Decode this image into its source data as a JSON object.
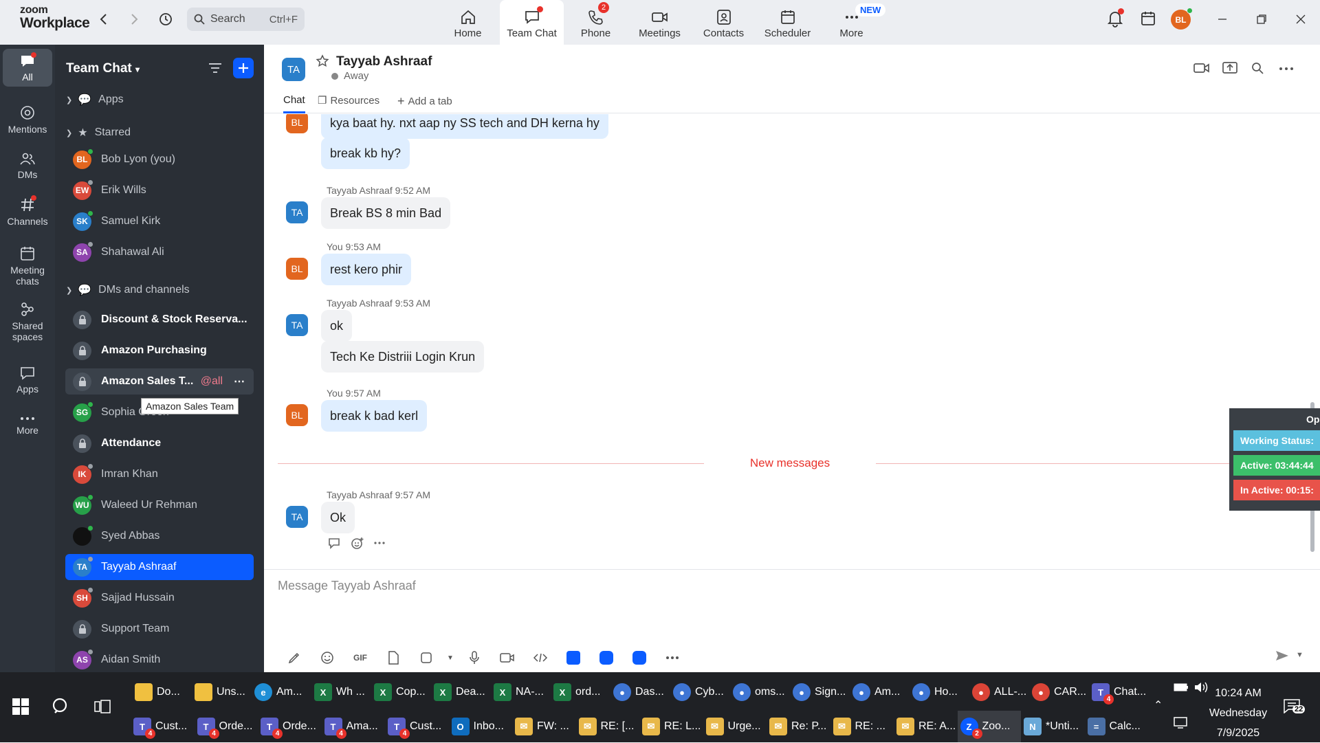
{
  "app": {
    "brand_top": "zoom",
    "brand_bottom": "Workplace"
  },
  "search": {
    "placeholder": "Search",
    "shortcut": "Ctrl+F"
  },
  "nav_tabs": [
    {
      "label": "Home",
      "icon": "home-icon"
    },
    {
      "label": "Team Chat",
      "icon": "team-chat-icon",
      "active": true
    },
    {
      "label": "Phone",
      "icon": "phone-icon",
      "badge": "2"
    },
    {
      "label": "Meetings",
      "icon": "video-icon"
    },
    {
      "label": "Contacts",
      "icon": "contacts-icon"
    },
    {
      "label": "Scheduler",
      "icon": "calendar-icon"
    },
    {
      "label": "More",
      "icon": "more-icon",
      "tag": "NEW"
    }
  ],
  "profile": {
    "initials": "BL",
    "status_color": "#2fb54b"
  },
  "left_rail": [
    {
      "label": "All",
      "icon": "chat-bubble-icon",
      "active": true
    },
    {
      "label": "Mentions",
      "icon": "at-icon"
    },
    {
      "label": "DMs",
      "icon": "people-icon"
    },
    {
      "label": "Channels",
      "icon": "hash-icon"
    },
    {
      "label": "Meeting chats",
      "icon": "calendar-icon"
    },
    {
      "label": "Shared spaces",
      "icon": "shared-icon"
    },
    {
      "label": "Apps",
      "icon": "apps-icon"
    },
    {
      "label": "More",
      "icon": "more-icon"
    }
  ],
  "sidebar": {
    "title": "Team Chat",
    "apps_label": "Apps",
    "starred_label": "Starred",
    "dms_label": "DMs and channels",
    "starred": [
      {
        "name": "Bob Lyon (you)",
        "initials": "BL",
        "color": "#e2661f",
        "status": "#2fb54b"
      },
      {
        "name": "Erik Wills",
        "initials": "EW",
        "color": "#d94a3b",
        "status": "#9aa0a6"
      },
      {
        "name": "Samuel Kirk",
        "initials": "SK",
        "color": "#2a7fca",
        "status": "#2fb54b"
      },
      {
        "name": "Shahawal Ali",
        "initials": "SA",
        "color": "#8e44ad",
        "status": "#9aa0a6"
      }
    ],
    "channels": [
      {
        "name": "Discount & Stock Reserva...",
        "type": "lock",
        "bold": true
      },
      {
        "name": "Amazon Purchasing",
        "type": "lock",
        "bold": true
      },
      {
        "name": "Amazon Sales T...",
        "type": "lock",
        "bold": true,
        "mention": "@all"
      },
      {
        "name": "Sophia Green",
        "initials": "SG",
        "color": "#27a049",
        "status": "#2fb54b"
      },
      {
        "name": "Attendance",
        "type": "lock",
        "bold": true
      },
      {
        "name": "Imran Khan",
        "initials": "IK",
        "color": "#d94a3b",
        "status": "#9aa0a6"
      },
      {
        "name": "Waleed Ur Rehman",
        "initials": "WU",
        "color": "#27a049",
        "status": "#2fb54b"
      },
      {
        "name": "Syed Abbas",
        "initials": "",
        "color": "#111111",
        "status": "#2fb54b"
      },
      {
        "name": "Tayyab Ashraaf",
        "initials": "TA",
        "color": "#2a7fca",
        "status": "#9aa0a6",
        "selected": true
      },
      {
        "name": "Sajjad Hussain",
        "initials": "SH",
        "color": "#d94a3b",
        "status": "#9aa0a6"
      },
      {
        "name": "Support Team",
        "type": "lock"
      },
      {
        "name": "Aidan Smith",
        "initials": "AS",
        "color": "#8e44ad",
        "status": "#9aa0a6"
      }
    ],
    "tooltip": "Amazon Sales Team"
  },
  "chat": {
    "initials": "TA",
    "name": "Tayyab Ashraaf",
    "status": "Away",
    "tabs": [
      "Chat",
      "Resources",
      "Add a tab"
    ],
    "messages": [
      {
        "type": "bubble",
        "from": "me",
        "text": "kya baat hy. nxt aap ny SS tech and DH kerna hy",
        "avatar": true
      },
      {
        "type": "bubble",
        "from": "me",
        "text": "break kb hy?"
      },
      {
        "type": "meta",
        "text": "Tayyab Ashraaf 9:52 AM"
      },
      {
        "type": "bubble",
        "from": "them",
        "text": "Break BS 8 min Bad",
        "avatar": true
      },
      {
        "type": "meta",
        "text": "You 9:53 AM"
      },
      {
        "type": "bubble",
        "from": "me",
        "text": "rest kero phir",
        "avatar": true
      },
      {
        "type": "meta",
        "text": "Tayyab Ashraaf 9:53 AM"
      },
      {
        "type": "bubble",
        "from": "them",
        "text": "ok",
        "avatar": true
      },
      {
        "type": "bubble",
        "from": "them",
        "text": "Tech Ke Distriii Login Krun"
      },
      {
        "type": "meta",
        "text": "You 9:57 AM"
      },
      {
        "type": "bubble",
        "from": "me",
        "text": "break k bad kerl",
        "avatar": true
      },
      {
        "type": "meta",
        "text": "Tayyab Ashraaf 9:57 AM"
      },
      {
        "type": "bubble",
        "from": "them",
        "text": "Ok",
        "avatar": true
      }
    ],
    "my_initials": "BL",
    "my_color": "#e2661f",
    "their_color": "#2a7fca",
    "new_messages_label": "New messages",
    "compose_placeholder": "Message Tayyab Ashraaf"
  },
  "overlay": {
    "title": "Op",
    "rows": [
      {
        "text": "Working Status:",
        "color": "#5bc0de"
      },
      {
        "text": "Active: 03:44:44",
        "color": "#3cbf6a"
      },
      {
        "text": "In Active: 00:15:",
        "color": "#e8534a"
      }
    ]
  },
  "taskbar": {
    "row1": [
      {
        "label": "Do...",
        "icon": "folder-icon",
        "color": "#f0c040"
      },
      {
        "label": "Uns...",
        "icon": "folder-icon",
        "color": "#f0c040"
      },
      {
        "label": "Am...",
        "icon": "edge-icon",
        "color": "#1f8fd6"
      },
      {
        "label": "Wh ...",
        "icon": "excel-icon",
        "color": "#1d7a44"
      },
      {
        "label": "Cop...",
        "icon": "excel-icon",
        "color": "#1d7a44"
      },
      {
        "label": "Dea...",
        "icon": "excel-icon",
        "color": "#1d7a44"
      },
      {
        "label": "NA-...",
        "icon": "excel-icon",
        "color": "#1d7a44"
      },
      {
        "label": "ord...",
        "icon": "excel-icon",
        "color": "#1d7a44"
      },
      {
        "label": "Das...",
        "icon": "chrome-icon",
        "color": "#3e75d4"
      },
      {
        "label": "Cyb...",
        "icon": "chrome-icon",
        "color": "#3e75d4"
      },
      {
        "label": "oms...",
        "icon": "chrome-icon",
        "color": "#3e75d4"
      },
      {
        "label": "Sign...",
        "icon": "chrome-icon",
        "color": "#3e75d4"
      },
      {
        "label": "Am...",
        "icon": "chrome-icon",
        "color": "#3e75d4"
      },
      {
        "label": "Ho...",
        "icon": "chrome-icon",
        "color": "#3e75d4"
      },
      {
        "label": "ALL-...",
        "icon": "chrome-icon",
        "color": "#db4437"
      },
      {
        "label": "CAR...",
        "icon": "chrome-icon",
        "color": "#db4437"
      },
      {
        "label": "Chat...",
        "icon": "teams-icon",
        "color": "#5b5fc7",
        "badge": "4"
      }
    ],
    "row2": [
      {
        "label": "Cust...",
        "icon": "teams-icon",
        "color": "#5b5fc7",
        "badge": "4"
      },
      {
        "label": "Orde...",
        "icon": "teams-icon",
        "color": "#5b5fc7",
        "badge": "4"
      },
      {
        "label": "Orde...",
        "icon": "teams-icon",
        "color": "#5b5fc7",
        "badge": "4"
      },
      {
        "label": "Ama...",
        "icon": "teams-icon",
        "color": "#5b5fc7",
        "badge": "4"
      },
      {
        "label": "Cust...",
        "icon": "teams-icon",
        "color": "#5b5fc7",
        "badge": "4"
      },
      {
        "label": "Inbo...",
        "icon": "outlook-icon",
        "color": "#0f6cbd"
      },
      {
        "label": "FW: ...",
        "icon": "mail-icon",
        "color": "#e8b84a"
      },
      {
        "label": "RE: [...",
        "icon": "mail-icon",
        "color": "#e8b84a"
      },
      {
        "label": "RE: L...",
        "icon": "mail-icon",
        "color": "#e8b84a"
      },
      {
        "label": "Urge...",
        "icon": "mail-icon",
        "color": "#e8b84a"
      },
      {
        "label": "Re: P...",
        "icon": "mail-icon",
        "color": "#e8b84a"
      },
      {
        "label": "RE: ...",
        "icon": "mail-icon",
        "color": "#e8b84a"
      },
      {
        "label": "RE: A...",
        "icon": "mail-icon",
        "color": "#e8b84a"
      },
      {
        "label": "Zoo...",
        "icon": "zoom-icon",
        "color": "#0b5cff",
        "badge": "2",
        "active": true
      },
      {
        "label": "*Unti...",
        "icon": "notepad-icon",
        "color": "#6aa9d8"
      },
      {
        "label": "Calc...",
        "icon": "calculator-icon",
        "color": "#4a6fa5"
      }
    ],
    "time": "10:24 AM",
    "day": "Wednesday",
    "date": "7/9/2025",
    "notif_count": "22"
  }
}
